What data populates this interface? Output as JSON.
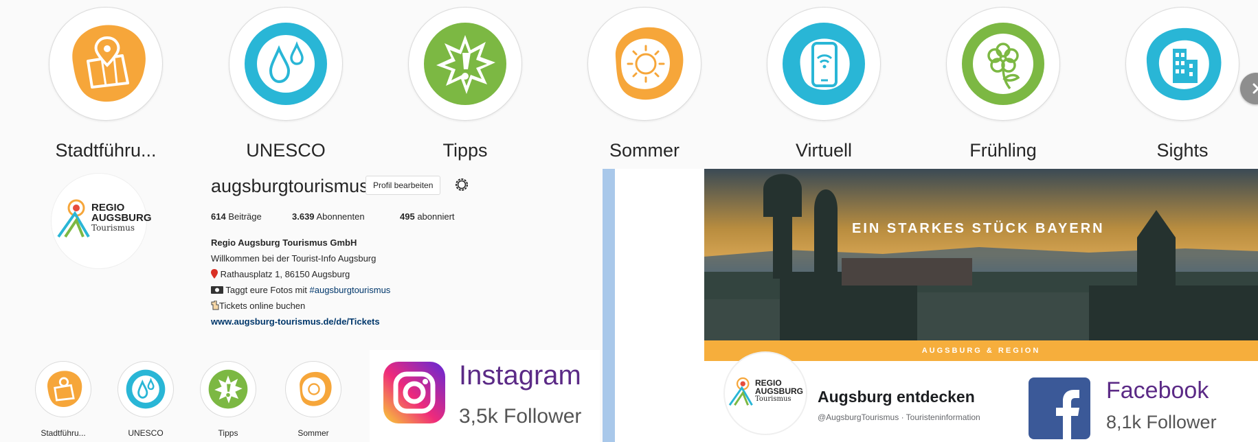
{
  "highlights": [
    {
      "label": "Stadtführu...",
      "icon": "map-pin-icon",
      "color": "#f6a63a"
    },
    {
      "label": "UNESCO",
      "icon": "water-drops-icon",
      "color": "#29b6d6"
    },
    {
      "label": "Tipps",
      "icon": "exclamation-star-icon",
      "color": "#7cb843"
    },
    {
      "label": "Sommer",
      "icon": "sun-icon",
      "color": "#f6a63a"
    },
    {
      "label": "Virtuell",
      "icon": "phone-wifi-icon",
      "color": "#29b6d6"
    },
    {
      "label": "Frühling",
      "icon": "flower-icon",
      "color": "#7cb843"
    },
    {
      "label": "Sights",
      "icon": "building-icon",
      "color": "#29b6d6"
    }
  ],
  "profile": {
    "username": "augsburgtourismus",
    "edit_button": "Profil bearbeiten",
    "stats": {
      "posts_count": "614",
      "posts_label": "Beiträge",
      "followers_count": "3.639",
      "followers_label": "Abonnenten",
      "following_count": "495",
      "following_label": "abonniert"
    },
    "bio": {
      "name": "Regio Augsburg Tourismus GmbH",
      "line1": "Willkommen bei der Tourist-Info Augsburg",
      "line2": "Rathausplatz 1, 86150 Augsburg",
      "line3_prefix": "Taggt eure Fotos mit ",
      "line3_hashtag": "#augsburgtourismus",
      "line4": "Tickets online buchen",
      "link": "www.augsburg-tourismus.de/de/Tickets"
    },
    "logo": {
      "line1": "REGIO",
      "line2": "AUGSBURG",
      "line3": "Tourismus"
    }
  },
  "mini_highlights": [
    {
      "label": "Stadtführu...",
      "color": "#f6a63a"
    },
    {
      "label": "UNESCO",
      "color": "#29b6d6"
    },
    {
      "label": "Tipps",
      "color": "#7cb843"
    },
    {
      "label": "Sommer",
      "color": "#f6a63a"
    }
  ],
  "instagram_badge": {
    "title": "Instagram",
    "followers": "3,5k Follower"
  },
  "facebook": {
    "cover_title": "EIN STARKES STÜCK BAYERN",
    "cover_subtitle": "AUGSBURG & REGION",
    "page_name": "Augsburg entdecken",
    "handle": "@AugsburgTourismus · Touristeninformation",
    "badge_title": "Facebook",
    "badge_followers": "8,1k Follower",
    "logo": {
      "line1": "REGIO",
      "line2": "AUGSBURG",
      "line3": "Tourismus"
    }
  },
  "colors": {
    "orange": "#f6a63a",
    "blue": "#29b6d6",
    "green": "#7cb843",
    "instagram_purple": "#5b2a86",
    "facebook_blue": "#3b5998"
  }
}
